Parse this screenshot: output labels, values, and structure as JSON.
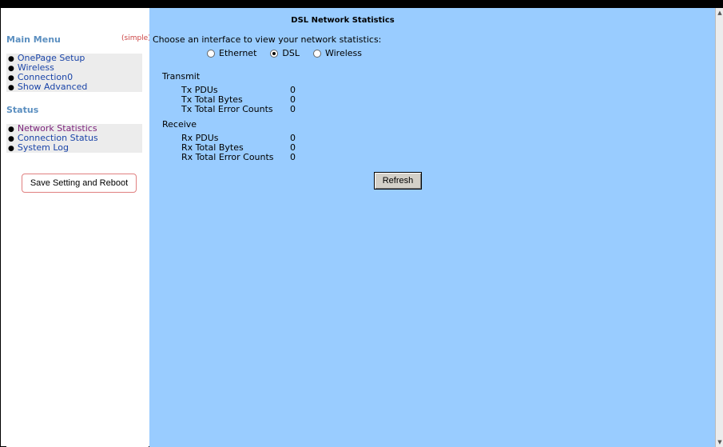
{
  "sidebar": {
    "main_menu_title": "Main Menu",
    "simple_link": "(simple)",
    "main_items": [
      {
        "label": "OnePage Setup"
      },
      {
        "label": "Wireless"
      },
      {
        "label": "Connection0"
      },
      {
        "label": "Show Advanced"
      }
    ],
    "status_title": "Status",
    "status_items": [
      {
        "label": "Network Statistics"
      },
      {
        "label": "Connection Status"
      },
      {
        "label": "System Log"
      }
    ],
    "save_button": "Save Setting and Reboot"
  },
  "main": {
    "title": "DSL Network Statistics",
    "choose_text": "Choose an interface to view your network statistics:",
    "interfaces": [
      {
        "label": "Ethernet",
        "selected": false
      },
      {
        "label": "DSL",
        "selected": true
      },
      {
        "label": "Wireless",
        "selected": false
      }
    ],
    "transmit": {
      "label": "Transmit",
      "rows": [
        {
          "label": "Tx PDUs",
          "value": "0"
        },
        {
          "label": "Tx Total Bytes",
          "value": "0"
        },
        {
          "label": "Tx Total Error Counts",
          "value": "0"
        }
      ]
    },
    "receive": {
      "label": "Receive",
      "rows": [
        {
          "label": "Rx PDUs",
          "value": "0"
        },
        {
          "label": "Rx Total Bytes",
          "value": "0"
        },
        {
          "label": "Rx Total Error Counts",
          "value": "0"
        }
      ]
    },
    "refresh_button": "Refresh"
  },
  "colors": {
    "main_background": "#99ccff",
    "link": "#1a44a8",
    "active_link": "#7a1f7a",
    "heading": "#5b8fc0"
  }
}
